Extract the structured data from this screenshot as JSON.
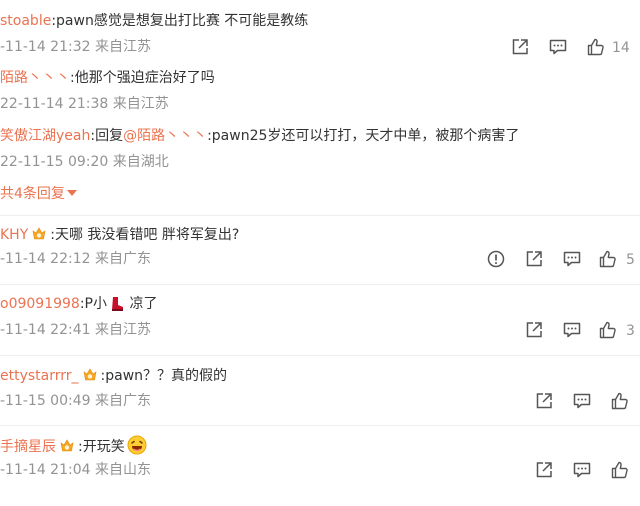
{
  "thread": {
    "main": {
      "user": "stoable",
      "text": ":pawn感觉是想复出打比赛 不可能是教练",
      "time": "-11-14 21:32 来自江苏",
      "likes": "14"
    },
    "replies": [
      {
        "user": "陌路丶丶丶",
        "text": ":他那个强迫症治好了吗",
        "time": "22-11-14 21:38 来自江苏"
      },
      {
        "user": "笑傲江湖yeah",
        "prefix": ":回复",
        "mention": "@陌路丶丶丶",
        "text": ":pawn25岁还可以打打，天才中单，被那个病害了",
        "time": "22-11-15 09:20 来自湖北"
      }
    ],
    "more_replies": "共4条回复"
  },
  "comments": [
    {
      "user": "KHY",
      "text": ":天哪 我没看错吧 胖将军复出?",
      "time": "-11-14 22:12 来自广东",
      "likes": "5"
    },
    {
      "user": "o09091998",
      "text": ":P小",
      "text2": "凉了",
      "time": "-11-14 22:41 来自江苏",
      "likes": "3"
    },
    {
      "user": "ettystarrrr_",
      "text": ":pawn？？真的假的",
      "time": "-11-15 00:49 来自广东",
      "likes": ""
    },
    {
      "user": "手摘星辰",
      "text": ":开玩笑",
      "time": "-11-14 21:04 来自山东",
      "likes": ""
    }
  ],
  "colors": {
    "username": "#eb7350",
    "meta": "#939393",
    "text": "#333333"
  }
}
